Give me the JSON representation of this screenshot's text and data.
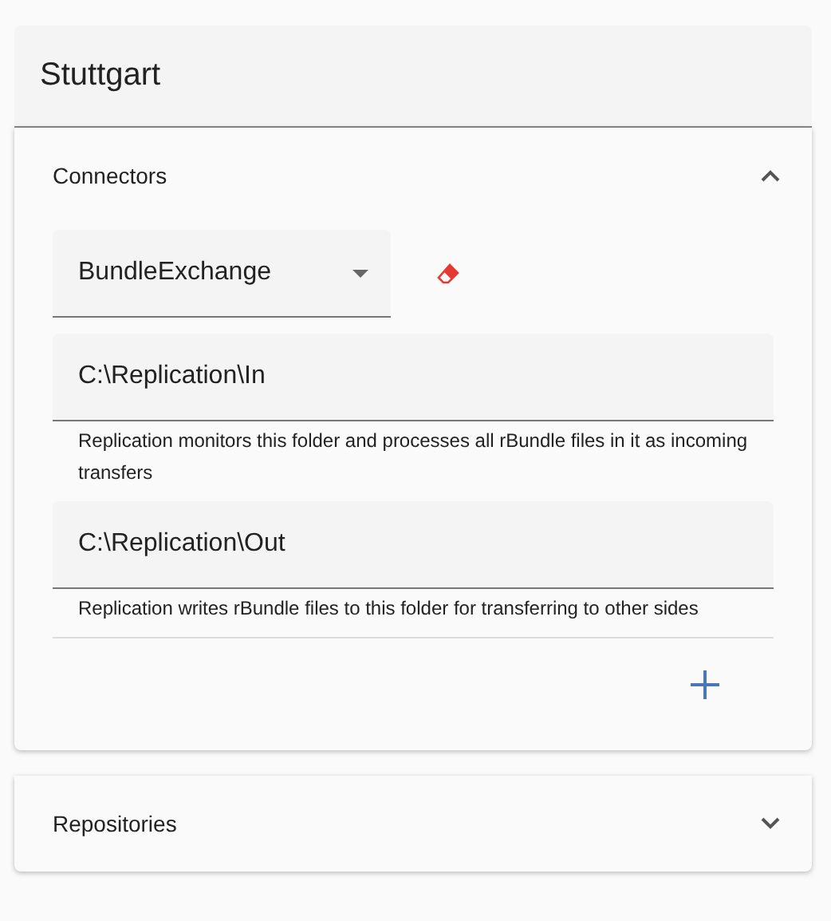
{
  "header": {
    "title": "Stuttgart"
  },
  "sections": [
    {
      "title": "Connectors",
      "expanded": true,
      "connector": {
        "value": "BundleExchange"
      },
      "fields": [
        {
          "value": "C:\\Replication\\In",
          "helper": "Replication monitors this folder and processes all rBundle files in it as incoming transfers"
        },
        {
          "value": "C:\\Replication\\Out",
          "helper": "Replication writes rBundle files to this folder for transferring to other sides"
        }
      ]
    },
    {
      "title": "Repositories",
      "expanded": false
    }
  ]
}
